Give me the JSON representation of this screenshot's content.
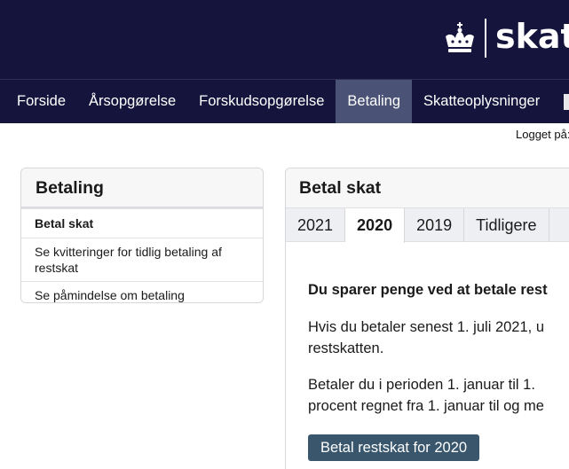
{
  "header": {
    "logo_text": "skat"
  },
  "nav": {
    "items": [
      {
        "label": "Forside",
        "active": false
      },
      {
        "label": "Årsopgørelse",
        "active": false
      },
      {
        "label": "Forskudsopgørelse",
        "active": false
      },
      {
        "label": "Betaling",
        "active": true
      },
      {
        "label": "Skatteoplysninger",
        "active": false
      }
    ]
  },
  "user": {
    "logged_in_label": "Logget på:"
  },
  "sidebar": {
    "title": "Betaling",
    "items": [
      {
        "label": "Betal skat",
        "active": true
      },
      {
        "label": "Se kvitteringer for tidlig betaling af restskat",
        "active": false
      },
      {
        "label": "Se påmindelse om betaling",
        "active": false
      }
    ]
  },
  "main": {
    "title": "Betal skat",
    "tabs": [
      {
        "label": "2021",
        "active": false
      },
      {
        "label": "2020",
        "active": true
      },
      {
        "label": "2019",
        "active": false
      },
      {
        "label": "Tidligere",
        "active": false
      }
    ],
    "headline": "Du sparer penge ved at betale rest",
    "paragraph1_line1": "Hvis du betaler senest 1. juli 2021, u",
    "paragraph1_line2": "restskatten.",
    "paragraph2_line1": "Betaler du i perioden 1. januar til 1.",
    "paragraph2_line2": "procent regnet fra 1. januar til og me",
    "cta_label": "Betal restskat for 2020"
  },
  "colors": {
    "header_bg": "#14143c",
    "nav_active_bg": "#4a5276",
    "cta_bg": "#39566c",
    "tabs_bg": "#eeeff3"
  }
}
